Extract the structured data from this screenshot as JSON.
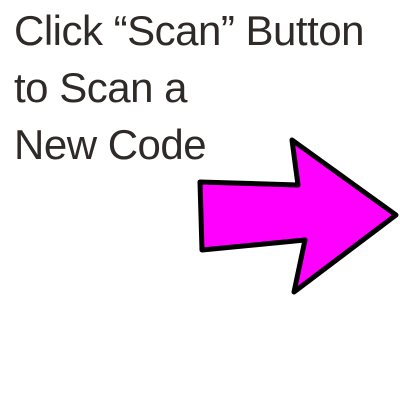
{
  "instruction": {
    "line1": "Click “Scan” Button",
    "line2": "to Scan a",
    "line3": "New Code"
  },
  "arrow": {
    "icon": "right-arrow-icon",
    "fill": "#ff00ff",
    "stroke": "#000000"
  },
  "colors": {
    "text": "#2f2a28",
    "background": "#ffffff"
  }
}
